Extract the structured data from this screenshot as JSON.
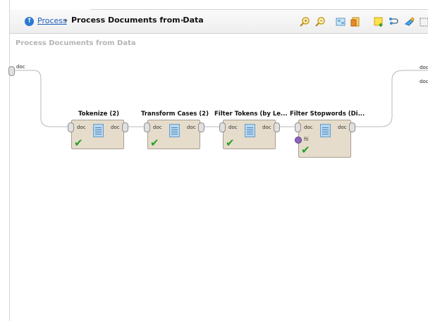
{
  "breadcrumb": {
    "root_label": "Process",
    "separator": "▸",
    "current_label": "Process Documents from Data",
    "trailing_separator": "▸"
  },
  "canvas": {
    "title": "Process Documents from Data",
    "input_port_label": "doc",
    "output_port_labels": [
      "doc",
      "doc"
    ]
  },
  "operators": [
    {
      "name": "Tokenize (2)",
      "in_port": "doc",
      "out_port": "doc",
      "status": "ok"
    },
    {
      "name": "Transform Cases (2)",
      "in_port": "doc",
      "out_port": "doc",
      "status": "ok"
    },
    {
      "name": "Filter Tokens (by Le...",
      "in_port": "doc",
      "out_port": "doc",
      "status": "ok"
    },
    {
      "name": "Filter Stopwords (Di...",
      "in_port": "doc",
      "out_port": "doc",
      "extra_port": "fil",
      "status": "ok"
    }
  ],
  "toolbar_icons": [
    "zoom-in-icon",
    "zoom-out-icon",
    "auto-fit-icon",
    "document-icon",
    "add-note-icon",
    "connect-icon",
    "cleanup-icon",
    "view-icon"
  ],
  "colors": {
    "operator_fill": "#e6dccb",
    "status_ok": "#22a122",
    "link": "#1d5fbf"
  }
}
